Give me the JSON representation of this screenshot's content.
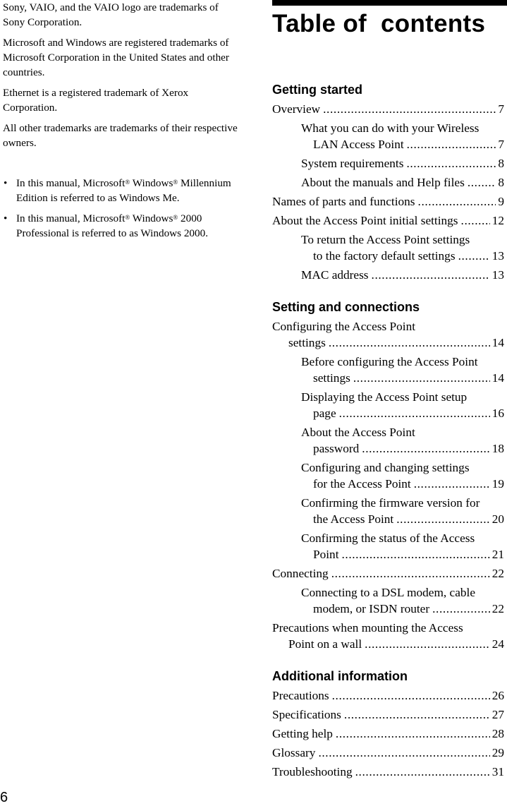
{
  "left_column": {
    "paragraphs": [
      "Sony, VAIO, and the VAIO logo are trademarks of Sony Corporation.",
      "Microsoft and Windows are registered trademarks of Microsoft Corporation in the United States and other countries.",
      "Ethernet is a registered trademark of Xerox Corporation.",
      "All other trademarks are trademarks of their respective owners."
    ],
    "notes": [
      {
        "pre": "In this manual, Microsoft",
        "mid": " Windows",
        "post": " Millennium Edition is referred to as Windows Me."
      },
      {
        "pre": "In this manual, Microsoft",
        "mid": " Windows",
        "post": " 2000 Professional is referred to as Windows 2000."
      }
    ],
    "reg_mark": "®",
    "bullet": "•"
  },
  "title": "Table of  contents",
  "toc": [
    {
      "heading": "Getting started",
      "entries": [
        {
          "level": 1,
          "lines": [
            "Overview"
          ],
          "page": "7"
        },
        {
          "level": 2,
          "lines": [
            "What you can do with your Wireless",
            "LAN Access Point"
          ],
          "page": "7"
        },
        {
          "level": 2,
          "lines": [
            "System requirements"
          ],
          "page": "8"
        },
        {
          "level": 2,
          "lines": [
            "About the manuals and Help files"
          ],
          "page": "8"
        },
        {
          "level": 1,
          "lines": [
            "Names of parts and functions"
          ],
          "page": "9"
        },
        {
          "level": 1,
          "lines": [
            "About the Access Point initial settings"
          ],
          "page": "12"
        },
        {
          "level": 2,
          "lines": [
            "To return the Access Point settings",
            "to the factory default settings"
          ],
          "page": "13"
        },
        {
          "level": 2,
          "lines": [
            "MAC address"
          ],
          "page": "13"
        }
      ]
    },
    {
      "heading": "Setting and connections",
      "entries": [
        {
          "level": 1,
          "lines": [
            "Configuring the Access Point",
            "settings"
          ],
          "page": "14"
        },
        {
          "level": 2,
          "lines": [
            "Before configuring the Access Point",
            "settings"
          ],
          "page": "14"
        },
        {
          "level": 2,
          "lines": [
            "Displaying the Access Point setup",
            "page"
          ],
          "page": "16"
        },
        {
          "level": 2,
          "lines": [
            "About the Access Point",
            "password"
          ],
          "page": "18"
        },
        {
          "level": 2,
          "lines": [
            "Configuring and changing settings",
            "for the Access Point"
          ],
          "page": "19"
        },
        {
          "level": 2,
          "lines": [
            "Confirming the firmware version for",
            "the Access Point"
          ],
          "page": "20"
        },
        {
          "level": 2,
          "lines": [
            "Confirming the status of the Access",
            "Point"
          ],
          "page": "21"
        },
        {
          "level": 1,
          "lines": [
            "Connecting"
          ],
          "page": "22"
        },
        {
          "level": 2,
          "lines": [
            "Connecting to a DSL modem, cable",
            "modem, or ISDN router"
          ],
          "page": "22"
        },
        {
          "level": 1,
          "lines": [
            "Precautions when mounting the Access",
            "Point on a wall"
          ],
          "page": "24"
        }
      ]
    },
    {
      "heading": "Additional information",
      "entries": [
        {
          "level": 1,
          "lines": [
            "Precautions"
          ],
          "page": "26"
        },
        {
          "level": 1,
          "lines": [
            "Specifications"
          ],
          "page": "27"
        },
        {
          "level": 1,
          "lines": [
            "Getting help"
          ],
          "page": "28"
        },
        {
          "level": 1,
          "lines": [
            "Glossary"
          ],
          "page": "29"
        },
        {
          "level": 1,
          "lines": [
            "Troubleshooting"
          ],
          "page": "31"
        }
      ]
    }
  ],
  "page_number": "6"
}
